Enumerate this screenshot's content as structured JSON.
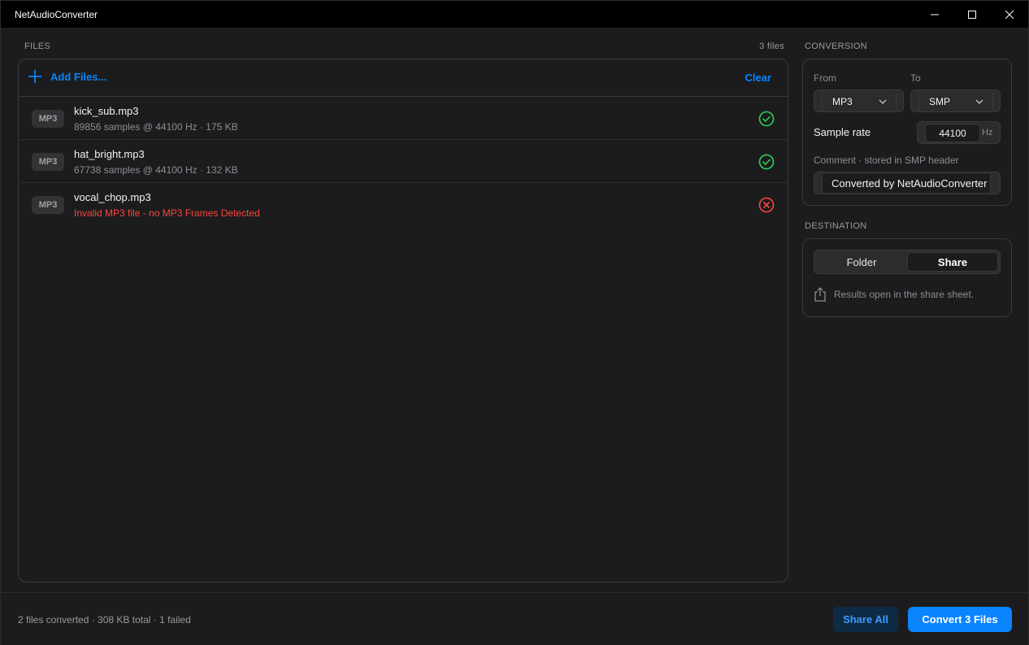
{
  "window": {
    "title": "NetAudioConverter"
  },
  "files": {
    "section_label": "FILES",
    "count_label": "3 files",
    "add_label": "Add Files...",
    "clear_label": "Clear",
    "items": [
      {
        "format": "MP3",
        "name": "kick_sub.mp3",
        "meta": "89856 samples @ 44100 Hz · 175 KB",
        "status": "success"
      },
      {
        "format": "MP3",
        "name": "hat_bright.mp3",
        "meta": "67738 samples @ 44100 Hz · 132 KB",
        "status": "success"
      },
      {
        "format": "MP3",
        "name": "vocal_chop.mp3",
        "meta": "Invalid MP3 file - no MP3 Frames Detected",
        "status": "error"
      }
    ]
  },
  "conversion": {
    "section_label": "CONVERSION",
    "from_label": "From",
    "from_value": "MP3",
    "to_label": "To",
    "to_value": "SMP",
    "rate_label": "Sample rate",
    "rate_value": "44100",
    "rate_unit": "Hz",
    "comment_label": "Comment · stored in SMP header",
    "comment_value": "Converted by NetAudioConverter"
  },
  "destination": {
    "section_label": "DESTINATION",
    "options": [
      "Folder",
      "Share"
    ],
    "selected": "Share",
    "note": "Results open in the share sheet."
  },
  "footer": {
    "status": "2 files converted · 308 KB total · 1 failed",
    "share_all_label": "Share All",
    "convert_label": "Convert 3 Files"
  },
  "colors": {
    "accent": "#0a84ff",
    "success": "#30d158",
    "error": "#ff453a"
  }
}
